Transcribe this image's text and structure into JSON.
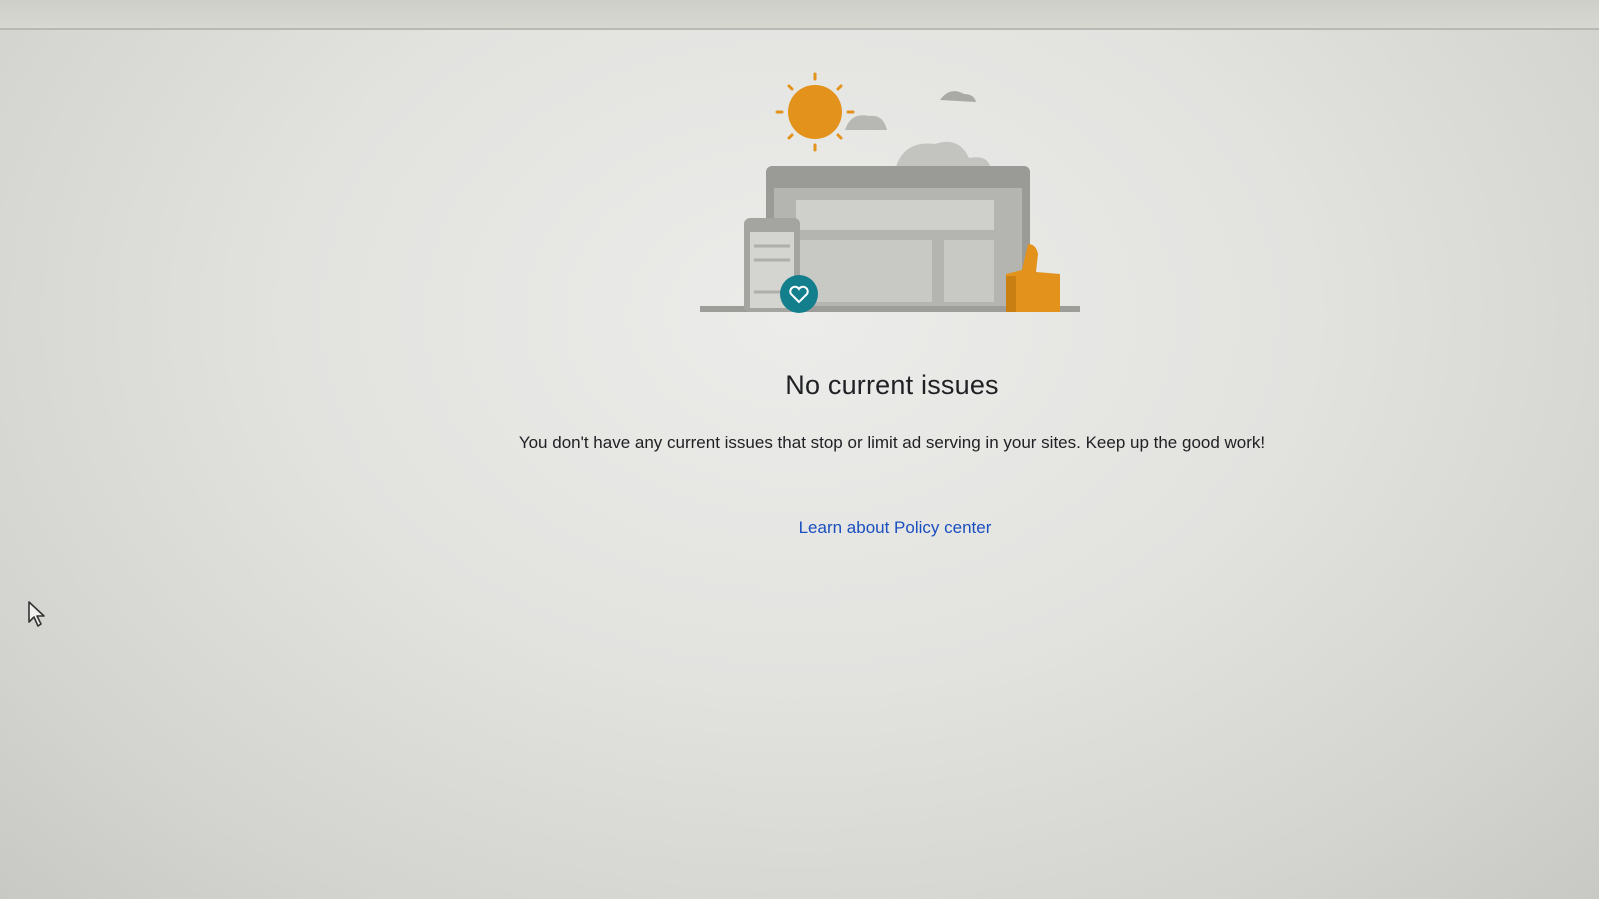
{
  "empty_state": {
    "title": "No current issues",
    "message": "You don't have any current issues that stop or limit ad serving in your sites. Keep up the good work!",
    "link_label": "Learn about Policy center",
    "illustration_icons": [
      "sun-icon",
      "cloud-icon",
      "browser-window-icon",
      "mobile-device-icon",
      "heart-badge-icon",
      "thumbs-up-icon"
    ]
  },
  "colors": {
    "link": "#1a4fbf",
    "sun": "#e3931b",
    "thumb": "#e3931b",
    "heart_badge": "#137e8c",
    "text": "#202124"
  }
}
